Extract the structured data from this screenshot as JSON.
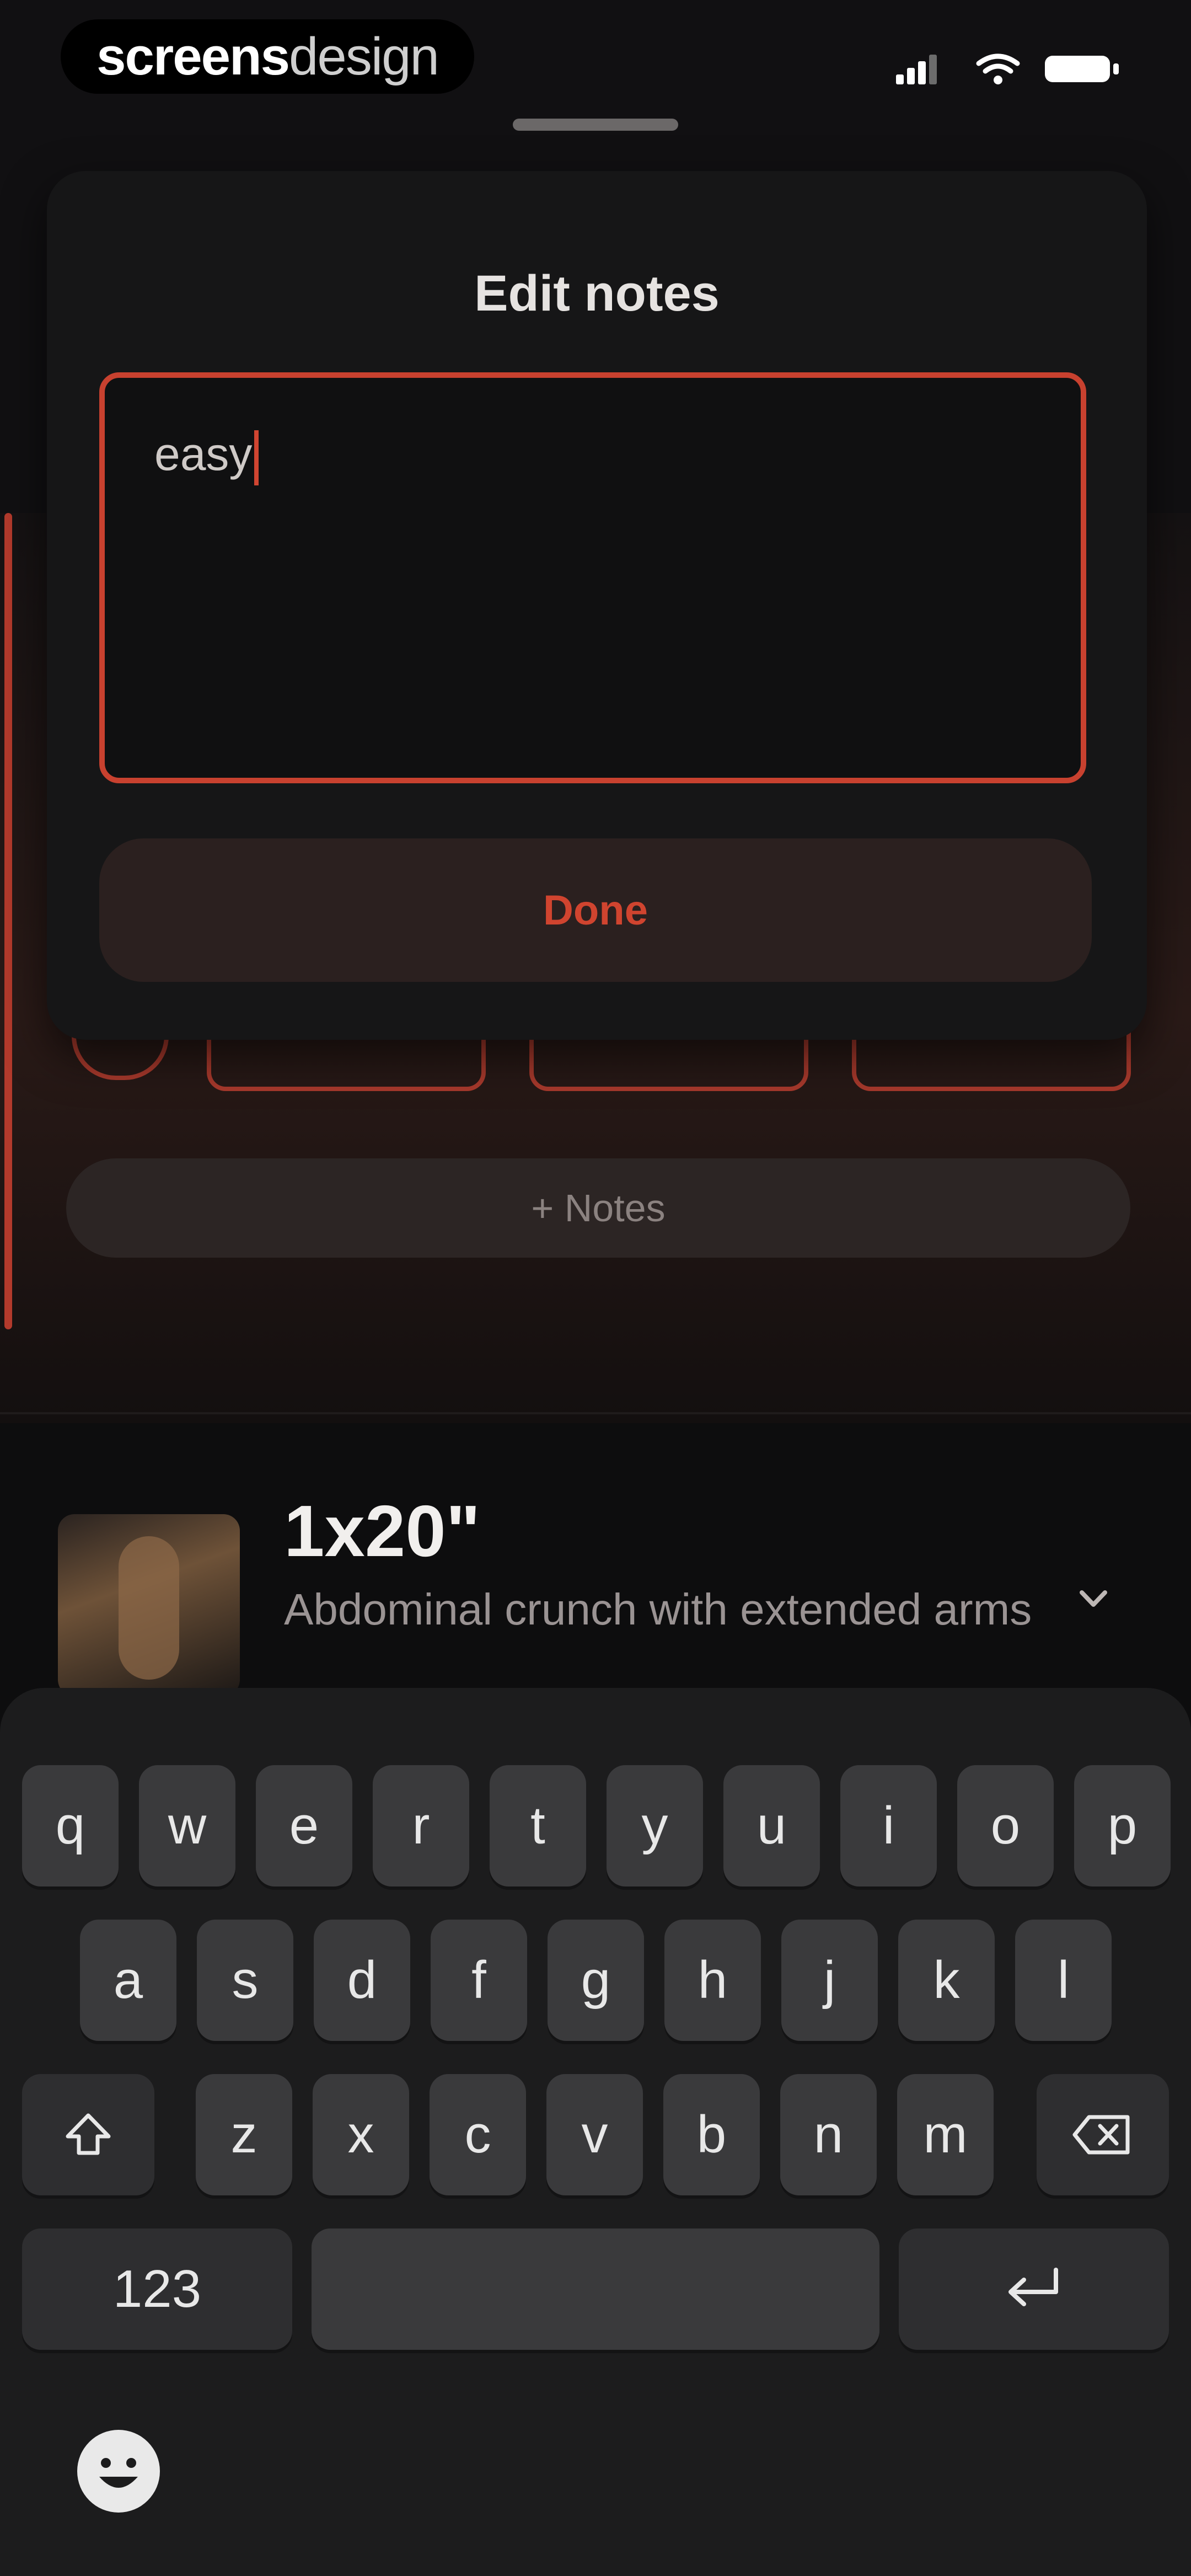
{
  "brand": {
    "part1": "screens",
    "part2": "design"
  },
  "modal": {
    "title": "Edit notes",
    "notes_value": "easy",
    "done_label": "Done"
  },
  "background": {
    "notes_button_label": "+ Notes",
    "exercise": {
      "title": "1x20\"",
      "name": "Abdominal crunch with extended arms"
    }
  },
  "keyboard": {
    "row1": [
      "q",
      "w",
      "e",
      "r",
      "t",
      "y",
      "u",
      "i",
      "o",
      "p"
    ],
    "row2": [
      "a",
      "s",
      "d",
      "f",
      "g",
      "h",
      "j",
      "k",
      "l"
    ],
    "row3": [
      "z",
      "x",
      "c",
      "v",
      "b",
      "n",
      "m"
    ],
    "numbers_label": "123"
  },
  "colors": {
    "accent": "#c8412f",
    "modal_bg": "#161617",
    "keyboard_bg": "#1c1c1d"
  },
  "icons": [
    "signal-icon",
    "wifi-icon",
    "battery-icon",
    "chevron-down-icon",
    "shift-icon",
    "backspace-icon",
    "return-icon",
    "emoji-icon"
  ]
}
